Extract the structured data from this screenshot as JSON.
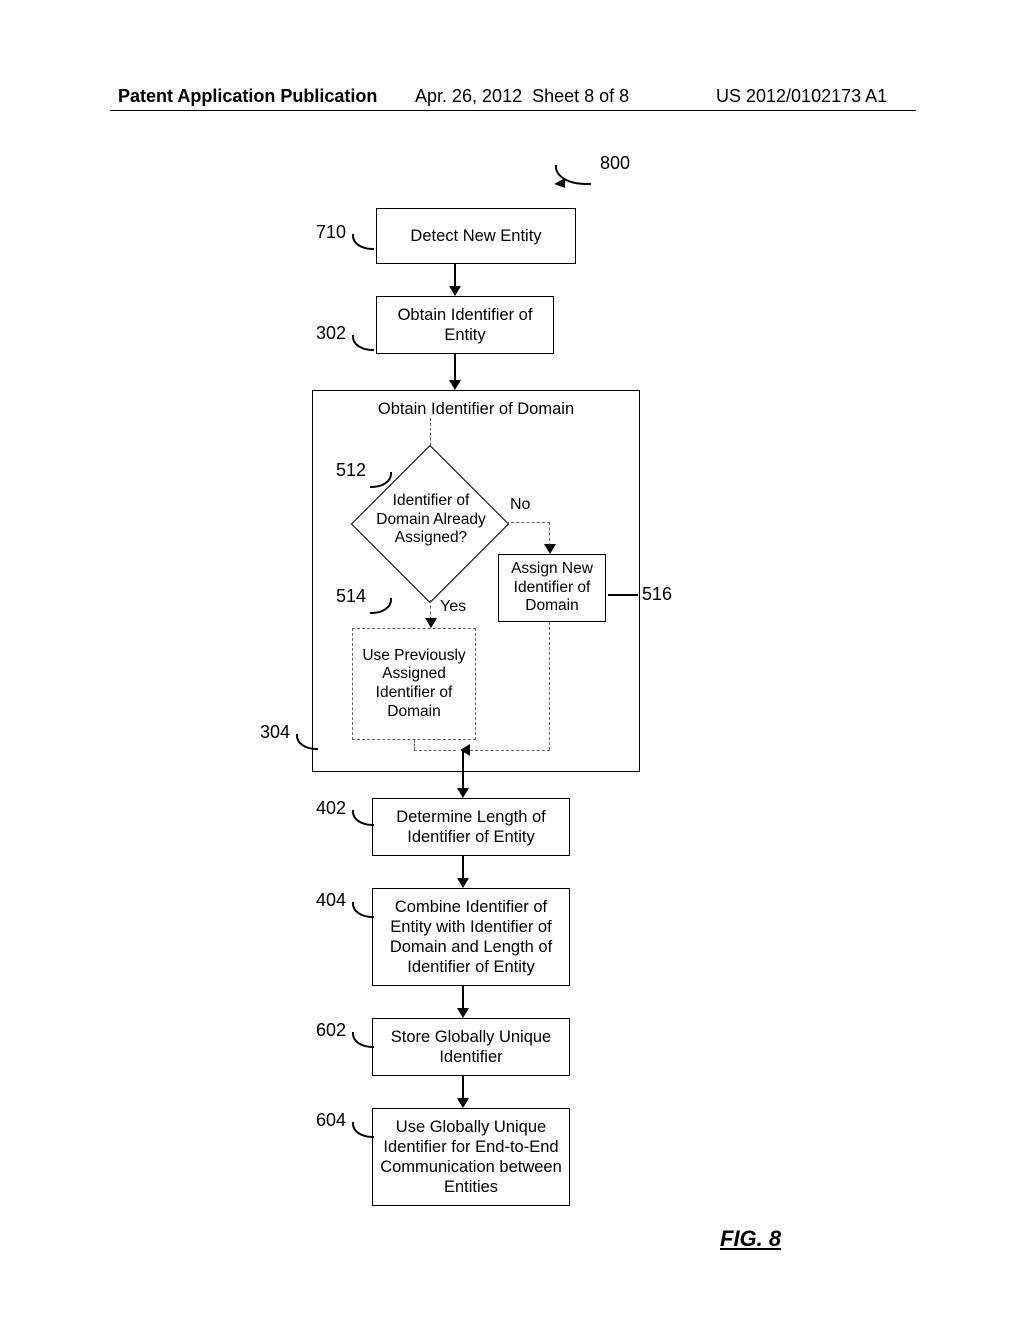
{
  "header": {
    "left": "Patent Application Publication",
    "mid_date": "Apr. 26, 2012",
    "mid_sheet": "Sheet 8 of 8",
    "right": "US 2012/0102173 A1"
  },
  "figure": {
    "label": "FIG. 8",
    "ref_top": "800"
  },
  "refs": {
    "r710": "710",
    "r302": "302",
    "r304": "304",
    "r512": "512",
    "r514": "514",
    "r516": "516",
    "r402": "402",
    "r404": "404",
    "r602": "602",
    "r604": "604"
  },
  "steps": {
    "s710": "Detect New Entity",
    "s302": "Obtain Identifier of Entity",
    "s304": "Obtain Identifier of Domain",
    "s512": "Identifier of\nDomain Already\nAssigned?",
    "yes": "Yes",
    "no": "No",
    "s514": "Use Previously Assigned Identifier of Domain",
    "s516": "Assign New Identifier of Domain",
    "s402": "Determine Length of Identifier of Entity",
    "s404": "Combine Identifier of Entity with Identifier of Domain and Length of Identifier of Entity",
    "s602": "Store Globally Unique Identifier",
    "s604": "Use Globally Unique Identifier for End-to-End Communication between Entities"
  }
}
